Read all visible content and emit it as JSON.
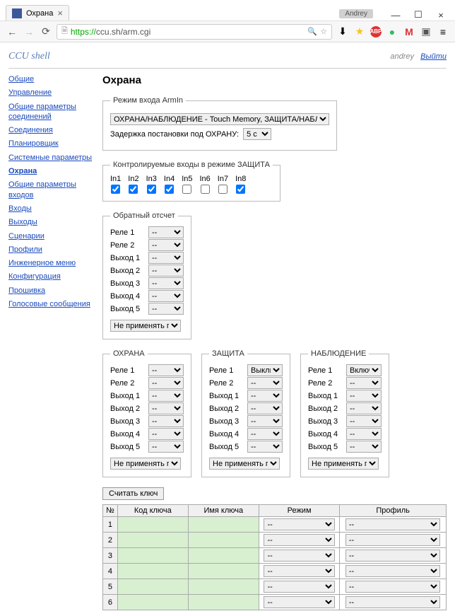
{
  "browser": {
    "tab_title": "Охрана",
    "user_badge": "Andrey",
    "url_proto": "https://",
    "url_host": "ccu.sh/arm.cgi"
  },
  "header": {
    "brand": "CCU shell",
    "username": "andrey",
    "logout": "Выйти"
  },
  "sidebar": {
    "items": [
      "Общие",
      "Управление",
      "Общие параметры соединений",
      "Соединения",
      "Планировщик",
      "Системные параметры",
      "Охрана",
      "Общие параметры входов",
      "Входы",
      "Выходы",
      "Сценарии",
      "Профили",
      "Инженерное меню",
      "Конфигурация",
      "Прошивка",
      "Голосовые сообщения"
    ],
    "active_index": 6
  },
  "page_title": "Охрана",
  "armin": {
    "legend": "Режим входа ArmIn",
    "mode": "ОХРАНА/НАБЛЮДЕНИЕ - Touch Memory, ЗАЩИТА/НАБЛЮДЕНИЕ - импульс",
    "delay_label": "Задержка постановки под ОХРАНУ:",
    "delay_value": "5 с"
  },
  "controlled": {
    "legend": "Контролируемые входы в режиме ЗАЩИТА",
    "inputs": [
      "In1",
      "In2",
      "In3",
      "In4",
      "In5",
      "In6",
      "In7",
      "In8"
    ],
    "checked": [
      true,
      true,
      true,
      true,
      false,
      false,
      false,
      true
    ]
  },
  "countdown": {
    "legend": "Обратный отсчет",
    "rows": [
      {
        "label": "Реле 1",
        "value": "--"
      },
      {
        "label": "Реле 2",
        "value": "--"
      },
      {
        "label": "Выход 1",
        "value": "--"
      },
      {
        "label": "Выход 2",
        "value": "--"
      },
      {
        "label": "Выход 3",
        "value": "--"
      },
      {
        "label": "Выход 4",
        "value": "--"
      },
      {
        "label": "Выход 5",
        "value": "--"
      }
    ],
    "profile": "Не применять профиль"
  },
  "modes": [
    {
      "legend": "ОХРАНА",
      "rows": [
        {
          "label": "Реле 1",
          "value": "--"
        },
        {
          "label": "Реле 2",
          "value": "--"
        },
        {
          "label": "Выход 1",
          "value": "--"
        },
        {
          "label": "Выход 2",
          "value": "--"
        },
        {
          "label": "Выход 3",
          "value": "--"
        },
        {
          "label": "Выход 4",
          "value": "--"
        },
        {
          "label": "Выход 5",
          "value": "--"
        }
      ],
      "profile": "Не применять профиль"
    },
    {
      "legend": "ЗАЩИТА",
      "rows": [
        {
          "label": "Реле 1",
          "value": "Выключить"
        },
        {
          "label": "Реле 2",
          "value": "--"
        },
        {
          "label": "Выход 1",
          "value": "--"
        },
        {
          "label": "Выход 2",
          "value": "--"
        },
        {
          "label": "Выход 3",
          "value": "--"
        },
        {
          "label": "Выход 4",
          "value": "--"
        },
        {
          "label": "Выход 5",
          "value": "--"
        }
      ],
      "profile": "Не применять профиль"
    },
    {
      "legend": "НАБЛЮДЕНИЕ",
      "rows": [
        {
          "label": "Реле 1",
          "value": "Включить"
        },
        {
          "label": "Реле 2",
          "value": "--"
        },
        {
          "label": "Выход 1",
          "value": "--"
        },
        {
          "label": "Выход 2",
          "value": "--"
        },
        {
          "label": "Выход 3",
          "value": "--"
        },
        {
          "label": "Выход 4",
          "value": "--"
        },
        {
          "label": "Выход 5",
          "value": "--"
        }
      ],
      "profile": "Не применять профиль"
    }
  ],
  "read_key_btn": "Считать ключ",
  "key_table": {
    "headers": [
      "№",
      "Код ключа",
      "Имя ключа",
      "Режим",
      "Профиль"
    ],
    "rows": [
      {
        "n": "1",
        "code": "",
        "name": "",
        "mode": "--",
        "profile": "--"
      },
      {
        "n": "2",
        "code": "",
        "name": "",
        "mode": "--",
        "profile": "--"
      },
      {
        "n": "3",
        "code": "",
        "name": "",
        "mode": "--",
        "profile": "--"
      },
      {
        "n": "4",
        "code": "",
        "name": "",
        "mode": "--",
        "profile": "--"
      },
      {
        "n": "5",
        "code": "",
        "name": "",
        "mode": "--",
        "profile": "--"
      },
      {
        "n": "6",
        "code": "",
        "name": "",
        "mode": "--",
        "profile": "--"
      }
    ]
  }
}
